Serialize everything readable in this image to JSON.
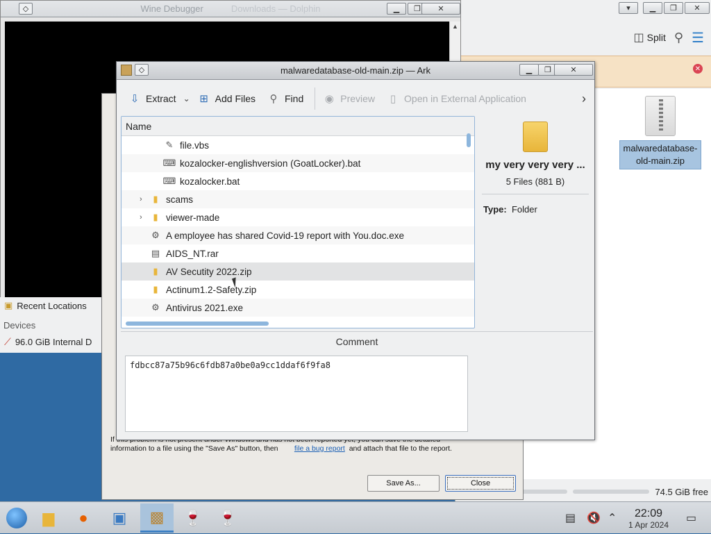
{
  "colors": {
    "accent": "#3d80c4",
    "selection": "#a7c4e0",
    "banner": "#f6e2c5",
    "close_red": "#da4453"
  },
  "dolphin": {
    "title": "Downloads — Dolphin",
    "toolbar": {
      "split_label": "Split",
      "search_icon": "search-icon",
      "menu_icon": "hamburger-icon"
    },
    "file": {
      "name": "malwaredatabase-old-main.zip"
    },
    "free_space": "74.5 GiB free"
  },
  "wine": {
    "title": "Wine Debugger",
    "crash": {
      "message_line1": "If this problem is not present under Windows and has not been reported yet, you can save the detailed",
      "message_line2_pre": "information to a file using the \"Save As\" button, then",
      "message_link": "file a bug report",
      "message_line2_post": "and attach that file to the report.",
      "save_as_label": "Save As...",
      "close_label": "Close"
    }
  },
  "places": {
    "recent_label": "Recent Locations",
    "devices_header": "Devices",
    "device_label": "96.0 GiB Internal D"
  },
  "ark": {
    "title": "malwaredatabase-old-main.zip — Ark",
    "toolbar": {
      "extract": "Extract",
      "add_files": "Add Files",
      "find": "Find",
      "preview": "Preview",
      "open_external": "Open in External Application"
    },
    "tree": {
      "header": "Name",
      "rows": [
        {
          "label": "file.vbs",
          "indent": 2,
          "icon": "script-icon"
        },
        {
          "label": "kozalocker-englishversion (GoatLocker).bat",
          "indent": 2,
          "icon": "batch-icon"
        },
        {
          "label": "kozalocker.bat",
          "indent": 2,
          "icon": "batch-icon"
        },
        {
          "label": "scams",
          "indent": 1,
          "icon": "folder-icon",
          "expandable": true
        },
        {
          "label": "viewer-made",
          "indent": 1,
          "icon": "folder-icon",
          "expandable": true
        },
        {
          "label": "A employee has shared Covid-19 report with You.doc.exe",
          "indent": 1,
          "icon": "executable-icon"
        },
        {
          "label": "AIDS_NT.rar",
          "indent": 1,
          "icon": "archive-icon"
        },
        {
          "label": "AV Secutity 2022.zip",
          "indent": 1,
          "icon": "zip-icon",
          "selected": true
        },
        {
          "label": "Actinum1.2-Safety.zip",
          "indent": 1,
          "icon": "zip-icon"
        },
        {
          "label": "Antivirus 2021.exe",
          "indent": 1,
          "icon": "executable-icon"
        }
      ]
    },
    "info": {
      "name": "my very very very ...",
      "count": "5 Files (881 B)",
      "type_label": "Type:",
      "type_value": "Folder"
    },
    "comment": {
      "label": "Comment",
      "text": "fdbcc87a75b96c6fdb87a0be0a9cc1ddaf6f9fa8"
    }
  },
  "taskbar": {
    "time": "22:09",
    "date": "1 Apr 2024"
  }
}
